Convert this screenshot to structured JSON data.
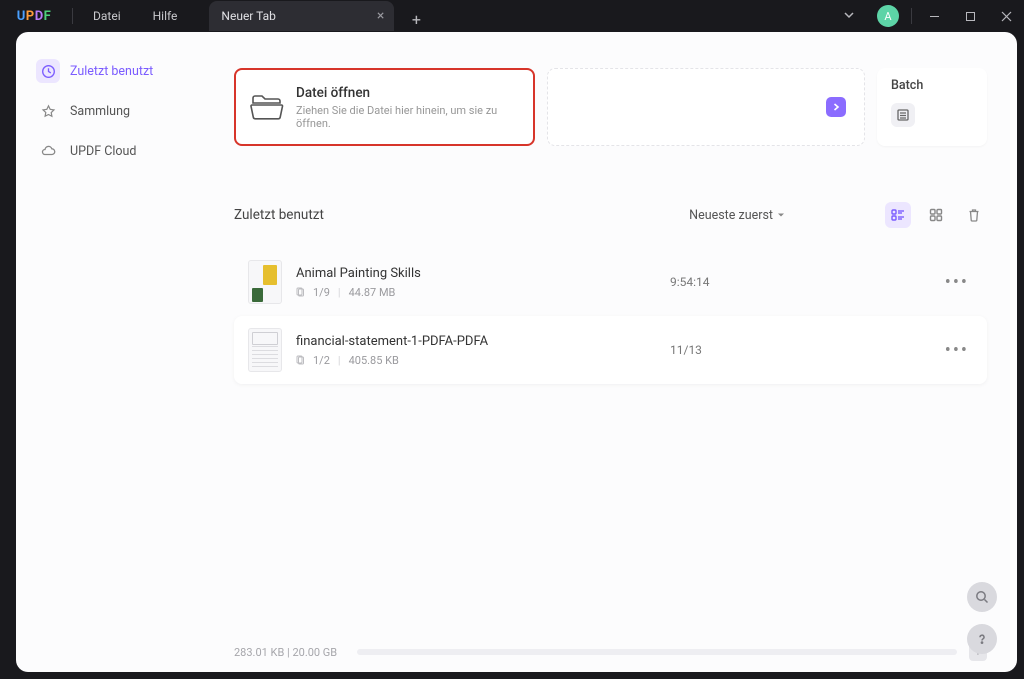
{
  "logo": {
    "u": "U",
    "p": "P",
    "d": "D",
    "f": "F"
  },
  "menu": {
    "file": "Datei",
    "help": "Hilfe"
  },
  "tab": {
    "title": "Neuer Tab"
  },
  "avatar": "A",
  "sidebar": {
    "items": [
      {
        "label": "Zuletzt benutzt"
      },
      {
        "label": "Sammlung"
      },
      {
        "label": "UPDF Cloud"
      }
    ]
  },
  "open": {
    "title": "Datei öffnen",
    "subtitle": "Ziehen Sie die Datei hier hinein, um sie zu öffnen."
  },
  "batch": {
    "label": "Batch"
  },
  "recent": {
    "header": "Zuletzt benutzt",
    "sort": "Neueste zuerst",
    "files": [
      {
        "name": "Animal Painting Skills",
        "pages": "1/9",
        "size": "44.87 MB",
        "time": "9:54:14"
      },
      {
        "name": "financial-statement-1-PDFA-PDFA",
        "pages": "1/2",
        "size": "405.85 KB",
        "time": "11/13"
      }
    ]
  },
  "status": {
    "used": "283.01 KB",
    "total": "20.00 GB",
    "sep": " | "
  }
}
